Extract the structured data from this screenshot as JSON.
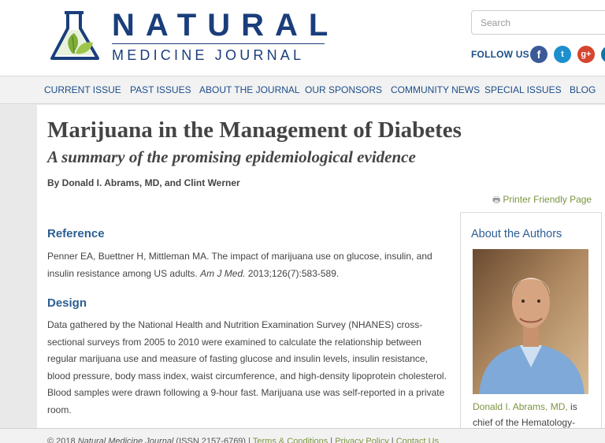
{
  "header": {
    "logo_title": "NATURAL",
    "logo_subtitle": "MEDICINE JOURNAL",
    "search_placeholder": "Search",
    "follow_label": "FOLLOW US",
    "social": {
      "facebook": "f",
      "twitter": "t",
      "googleplus": "g+",
      "linkedin": "in"
    }
  },
  "nav": {
    "items": [
      "CURRENT ISSUE",
      "PAST ISSUES",
      "ABOUT THE JOURNAL",
      "OUR SPONSORS",
      "COMMUNITY NEWS",
      "SPECIAL ISSUES",
      "BLOG"
    ]
  },
  "article": {
    "title": "Marijuana in the Management of Diabetes",
    "subtitle": "A summary of the promising epidemiological evidence",
    "byline": "By Donald I. Abrams, MD, and Clint Werner",
    "print_link": "Printer Friendly Page",
    "reference": {
      "heading": "Reference",
      "text_before": "Penner EA, Buettner H, Mittleman MA. The impact of marijuana use on glucose, insulin, and insulin resistance among US adults. ",
      "journal": "Am J Med.",
      "text_after": " 2013;126(7):583-589."
    },
    "design": {
      "heading": "Design",
      "text": "Data gathered by the National Health and Nutrition Examination Survey (NHANES) cross-sectional surveys from 2005 to 2010 were examined to calculate the relationship between regular marijuana use and measure of fasting glucose and insulin levels, insulin resistance, blood pressure, body mass index, waist circumference, and high-density lipoprotein cholesterol. Blood samples were drawn following a 9-hour fast. Marijuana use was self-reported in a private room."
    }
  },
  "authors": {
    "heading": "About the Authors",
    "author_name": "Donald I. Abrams, MD,",
    "author_suffix": " is chief of the Hematology-"
  },
  "footer": {
    "copyright_prefix": "© 2018 ",
    "journal_name": "Natural Medicine Journal",
    "issn": " (ISSN 2157-6769) | ",
    "terms": "Terms & Conditions",
    "sep1": " | ",
    "privacy": "Privacy Policy",
    "sep2": " | ",
    "contact": "Contact Us"
  },
  "colors": {
    "brand_blue": "#1a3e7b",
    "link_blue": "#1d4e8a",
    "heading_blue": "#2c5e93",
    "link_green": "#7c9440"
  }
}
